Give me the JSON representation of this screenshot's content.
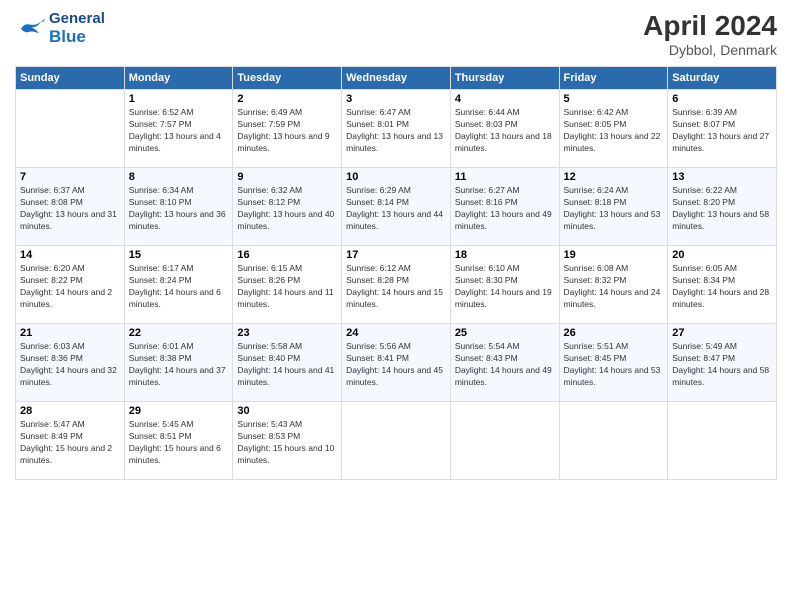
{
  "header": {
    "logo_general": "General",
    "logo_blue": "Blue",
    "title": "April 2024",
    "location": "Dybbol, Denmark"
  },
  "days": [
    "Sunday",
    "Monday",
    "Tuesday",
    "Wednesday",
    "Thursday",
    "Friday",
    "Saturday"
  ],
  "weeks": [
    [
      {
        "num": "",
        "sunrise": "",
        "sunset": "",
        "daylight": ""
      },
      {
        "num": "1",
        "sunrise": "Sunrise: 6:52 AM",
        "sunset": "Sunset: 7:57 PM",
        "daylight": "Daylight: 13 hours and 4 minutes."
      },
      {
        "num": "2",
        "sunrise": "Sunrise: 6:49 AM",
        "sunset": "Sunset: 7:59 PM",
        "daylight": "Daylight: 13 hours and 9 minutes."
      },
      {
        "num": "3",
        "sunrise": "Sunrise: 6:47 AM",
        "sunset": "Sunset: 8:01 PM",
        "daylight": "Daylight: 13 hours and 13 minutes."
      },
      {
        "num": "4",
        "sunrise": "Sunrise: 6:44 AM",
        "sunset": "Sunset: 8:03 PM",
        "daylight": "Daylight: 13 hours and 18 minutes."
      },
      {
        "num": "5",
        "sunrise": "Sunrise: 6:42 AM",
        "sunset": "Sunset: 8:05 PM",
        "daylight": "Daylight: 13 hours and 22 minutes."
      },
      {
        "num": "6",
        "sunrise": "Sunrise: 6:39 AM",
        "sunset": "Sunset: 8:07 PM",
        "daylight": "Daylight: 13 hours and 27 minutes."
      }
    ],
    [
      {
        "num": "7",
        "sunrise": "Sunrise: 6:37 AM",
        "sunset": "Sunset: 8:08 PM",
        "daylight": "Daylight: 13 hours and 31 minutes."
      },
      {
        "num": "8",
        "sunrise": "Sunrise: 6:34 AM",
        "sunset": "Sunset: 8:10 PM",
        "daylight": "Daylight: 13 hours and 36 minutes."
      },
      {
        "num": "9",
        "sunrise": "Sunrise: 6:32 AM",
        "sunset": "Sunset: 8:12 PM",
        "daylight": "Daylight: 13 hours and 40 minutes."
      },
      {
        "num": "10",
        "sunrise": "Sunrise: 6:29 AM",
        "sunset": "Sunset: 8:14 PM",
        "daylight": "Daylight: 13 hours and 44 minutes."
      },
      {
        "num": "11",
        "sunrise": "Sunrise: 6:27 AM",
        "sunset": "Sunset: 8:16 PM",
        "daylight": "Daylight: 13 hours and 49 minutes."
      },
      {
        "num": "12",
        "sunrise": "Sunrise: 6:24 AM",
        "sunset": "Sunset: 8:18 PM",
        "daylight": "Daylight: 13 hours and 53 minutes."
      },
      {
        "num": "13",
        "sunrise": "Sunrise: 6:22 AM",
        "sunset": "Sunset: 8:20 PM",
        "daylight": "Daylight: 13 hours and 58 minutes."
      }
    ],
    [
      {
        "num": "14",
        "sunrise": "Sunrise: 6:20 AM",
        "sunset": "Sunset: 8:22 PM",
        "daylight": "Daylight: 14 hours and 2 minutes."
      },
      {
        "num": "15",
        "sunrise": "Sunrise: 6:17 AM",
        "sunset": "Sunset: 8:24 PM",
        "daylight": "Daylight: 14 hours and 6 minutes."
      },
      {
        "num": "16",
        "sunrise": "Sunrise: 6:15 AM",
        "sunset": "Sunset: 8:26 PM",
        "daylight": "Daylight: 14 hours and 11 minutes."
      },
      {
        "num": "17",
        "sunrise": "Sunrise: 6:12 AM",
        "sunset": "Sunset: 8:28 PM",
        "daylight": "Daylight: 14 hours and 15 minutes."
      },
      {
        "num": "18",
        "sunrise": "Sunrise: 6:10 AM",
        "sunset": "Sunset: 8:30 PM",
        "daylight": "Daylight: 14 hours and 19 minutes."
      },
      {
        "num": "19",
        "sunrise": "Sunrise: 6:08 AM",
        "sunset": "Sunset: 8:32 PM",
        "daylight": "Daylight: 14 hours and 24 minutes."
      },
      {
        "num": "20",
        "sunrise": "Sunrise: 6:05 AM",
        "sunset": "Sunset: 8:34 PM",
        "daylight": "Daylight: 14 hours and 28 minutes."
      }
    ],
    [
      {
        "num": "21",
        "sunrise": "Sunrise: 6:03 AM",
        "sunset": "Sunset: 8:36 PM",
        "daylight": "Daylight: 14 hours and 32 minutes."
      },
      {
        "num": "22",
        "sunrise": "Sunrise: 6:01 AM",
        "sunset": "Sunset: 8:38 PM",
        "daylight": "Daylight: 14 hours and 37 minutes."
      },
      {
        "num": "23",
        "sunrise": "Sunrise: 5:58 AM",
        "sunset": "Sunset: 8:40 PM",
        "daylight": "Daylight: 14 hours and 41 minutes."
      },
      {
        "num": "24",
        "sunrise": "Sunrise: 5:56 AM",
        "sunset": "Sunset: 8:41 PM",
        "daylight": "Daylight: 14 hours and 45 minutes."
      },
      {
        "num": "25",
        "sunrise": "Sunrise: 5:54 AM",
        "sunset": "Sunset: 8:43 PM",
        "daylight": "Daylight: 14 hours and 49 minutes."
      },
      {
        "num": "26",
        "sunrise": "Sunrise: 5:51 AM",
        "sunset": "Sunset: 8:45 PM",
        "daylight": "Daylight: 14 hours and 53 minutes."
      },
      {
        "num": "27",
        "sunrise": "Sunrise: 5:49 AM",
        "sunset": "Sunset: 8:47 PM",
        "daylight": "Daylight: 14 hours and 58 minutes."
      }
    ],
    [
      {
        "num": "28",
        "sunrise": "Sunrise: 5:47 AM",
        "sunset": "Sunset: 8:49 PM",
        "daylight": "Daylight: 15 hours and 2 minutes."
      },
      {
        "num": "29",
        "sunrise": "Sunrise: 5:45 AM",
        "sunset": "Sunset: 8:51 PM",
        "daylight": "Daylight: 15 hours and 6 minutes."
      },
      {
        "num": "30",
        "sunrise": "Sunrise: 5:43 AM",
        "sunset": "Sunset: 8:53 PM",
        "daylight": "Daylight: 15 hours and 10 minutes."
      },
      {
        "num": "",
        "sunrise": "",
        "sunset": "",
        "daylight": ""
      },
      {
        "num": "",
        "sunrise": "",
        "sunset": "",
        "daylight": ""
      },
      {
        "num": "",
        "sunrise": "",
        "sunset": "",
        "daylight": ""
      },
      {
        "num": "",
        "sunrise": "",
        "sunset": "",
        "daylight": ""
      }
    ]
  ]
}
